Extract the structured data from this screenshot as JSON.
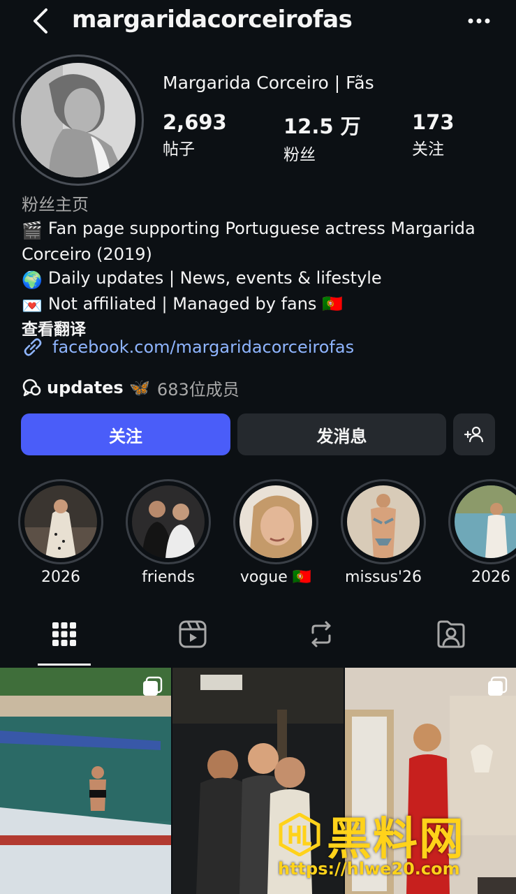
{
  "header": {
    "username": "margaridacorceirofas",
    "back_icon": "chevron-left-icon",
    "more_icon": "ellipsis-icon"
  },
  "profile": {
    "display_name": "Margarida Corceiro | Fãs",
    "stats": [
      {
        "value": "2,693",
        "label": "帖子"
      },
      {
        "value": "12.5 万",
        "label": "粉丝"
      },
      {
        "value": "173",
        "label": "关注"
      }
    ]
  },
  "bio": {
    "category": "粉丝主页",
    "line1_emoji": "🎬",
    "line1": "Fan page supporting Portuguese actress Margarida Corceiro (2019)",
    "line2_emoji": "🌍",
    "line2": "Daily updates | News, events & lifestyle",
    "line3_emoji": "💌",
    "line3": "Not affiliated | Managed by fans 🇵🇹",
    "translate": "查看翻译",
    "link": "facebook.com/margaridacorceirofas"
  },
  "channel": {
    "name": "updates 🦋",
    "members": "683位成员"
  },
  "actions": {
    "follow": "关注",
    "message": "发消息",
    "add_icon": "add-person-icon"
  },
  "highlights": [
    {
      "label": "2026"
    },
    {
      "label": "friends"
    },
    {
      "label": "vogue 🇵🇹"
    },
    {
      "label": "missus'26"
    },
    {
      "label": "2026"
    }
  ],
  "tabs": [
    {
      "name": "grid-icon",
      "active": true
    },
    {
      "name": "reels-icon",
      "active": false
    },
    {
      "name": "repost-icon",
      "active": false
    },
    {
      "name": "tagged-icon",
      "active": false
    }
  ],
  "watermark": {
    "title": "黑料网",
    "url": "https://hlwe20.com"
  },
  "colors": {
    "background": "#0c1014",
    "follow_button": "#4a5df9",
    "secondary_button": "#25292e",
    "link": "#8fb5ff",
    "muted_text": "#a8a8a8",
    "watermark": "#ffd21a"
  }
}
